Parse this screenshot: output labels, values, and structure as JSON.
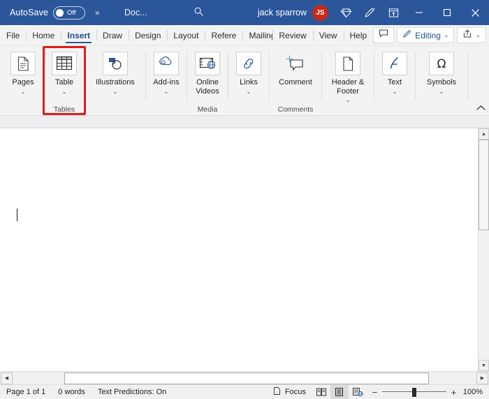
{
  "titlebar": {
    "autosave_label": "AutoSave",
    "autosave_state": "Off",
    "expand_icon": "chevron-double-right-icon",
    "document_title": "Doc...",
    "search_icon": "search-icon",
    "user_name": "jack sparrow",
    "user_initials": "JS",
    "icons": [
      {
        "name": "diamond-icon"
      },
      {
        "name": "pen-draw-icon"
      },
      {
        "name": "ribbon-display-options-icon"
      }
    ],
    "window_controls": {
      "minimize": "minimize-icon",
      "maximize": "maximize-icon",
      "close": "close-icon"
    },
    "background_color": "#2b579a",
    "avatar_color": "#c42b1c"
  },
  "tabs": [
    {
      "label": "File",
      "active": false
    },
    {
      "label": "Home",
      "active": false
    },
    {
      "label": "Insert",
      "active": true
    },
    {
      "label": "Draw",
      "active": false
    },
    {
      "label": "Design",
      "active": false
    },
    {
      "label": "Layout",
      "active": false
    },
    {
      "label": "Refere",
      "active": false
    },
    {
      "label": "Mailings",
      "active": false
    },
    {
      "label": "Review",
      "active": false
    },
    {
      "label": "View",
      "active": false
    },
    {
      "label": "Help",
      "active": false
    }
  ],
  "tabstrip_right": {
    "comment_icon": "comment-icon",
    "editing_label": "Editing",
    "editing_icon": "pen-icon",
    "editing_chevron": "chevron-down-icon",
    "share_icon": "share-icon",
    "share_chevron": "chevron-down-icon"
  },
  "ribbon": {
    "active_tab": "Insert",
    "groups": [
      {
        "title": "",
        "buttons": [
          {
            "label": "Pages",
            "icon": "pages-icon",
            "chevron": "⌄"
          }
        ]
      },
      {
        "title": "Tables",
        "highlighted": true,
        "buttons": [
          {
            "label": "Table",
            "icon": "table-icon",
            "chevron": "⌄"
          }
        ]
      },
      {
        "title": "",
        "buttons": [
          {
            "label": "Illustrations",
            "icon": "illustrations-icon",
            "chevron": "⌄"
          }
        ]
      },
      {
        "title": "",
        "buttons": [
          {
            "label": "Add-ins",
            "icon": "addins-icon",
            "chevron": "⌄"
          }
        ]
      },
      {
        "title": "Media",
        "buttons": [
          {
            "label": "Online Videos",
            "icon": "online-video-icon",
            "chevron": ""
          }
        ]
      },
      {
        "title": "",
        "buttons": [
          {
            "label": "Links",
            "icon": "links-icon",
            "chevron": "⌄"
          }
        ]
      },
      {
        "title": "Comments",
        "buttons": [
          {
            "label": "Comment",
            "icon": "new-comment-icon",
            "chevron": ""
          }
        ]
      },
      {
        "title": "",
        "buttons": [
          {
            "label": "Header & Footer",
            "icon": "header-footer-icon",
            "chevron": "⌄"
          }
        ]
      },
      {
        "title": "",
        "buttons": [
          {
            "label": "Text",
            "icon": "text-icon",
            "chevron": "⌄"
          }
        ]
      },
      {
        "title": "",
        "buttons": [
          {
            "label": "Symbols",
            "icon": "symbol-omega-icon",
            "chevron": "⌄"
          }
        ]
      }
    ],
    "collapse_icon": "chevron-up-icon",
    "highlight_color": "#e01b1b"
  },
  "document": {
    "caret_visible": true
  },
  "statusbar": {
    "page_info": "Page 1 of 1",
    "word_count": "0 words",
    "text_predictions": "Text Predictions: On",
    "focus_label": "Focus",
    "focus_icon": "focus-icon",
    "views": [
      {
        "name": "read-mode-icon",
        "active": false
      },
      {
        "name": "print-layout-icon",
        "active": true
      },
      {
        "name": "web-layout-icon",
        "active": false
      }
    ],
    "zoom_out": "−",
    "zoom_in": "+",
    "zoom_level": "100%"
  }
}
